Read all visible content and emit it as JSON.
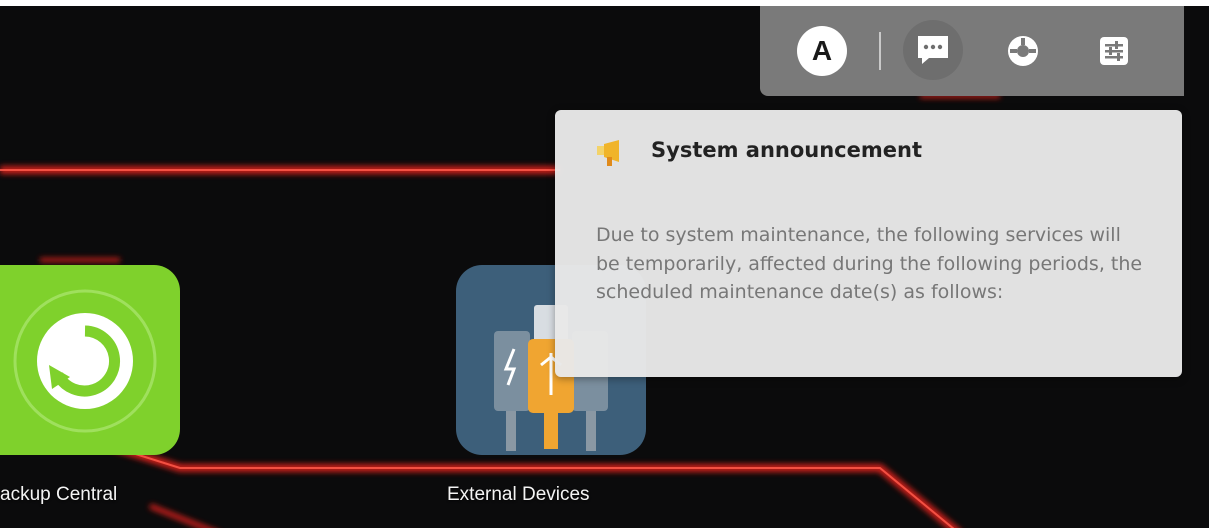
{
  "desktop": {
    "apps": [
      {
        "label": "ackup Central",
        "icon": "backup-central-icon"
      },
      {
        "label": "External Devices",
        "icon": "external-devices-icon"
      }
    ]
  },
  "tray": {
    "user_initial": "A",
    "icons": [
      "user-avatar-icon",
      "chat-icon",
      "settings-dial-icon",
      "control-panel-icon"
    ]
  },
  "announcement": {
    "title": "System announcement",
    "body": "Due to system maintenance, the following services will be temporarily, affected during the following periods, the scheduled maintenance date(s) as follows:",
    "icon": "megaphone-icon"
  },
  "colors": {
    "background": "#0b0b0c",
    "accent_red": "#e3201f",
    "backup_green": "#7fd12c",
    "tray_bg": "#7a7a7a",
    "popup_bg": "#e8e8e8"
  }
}
